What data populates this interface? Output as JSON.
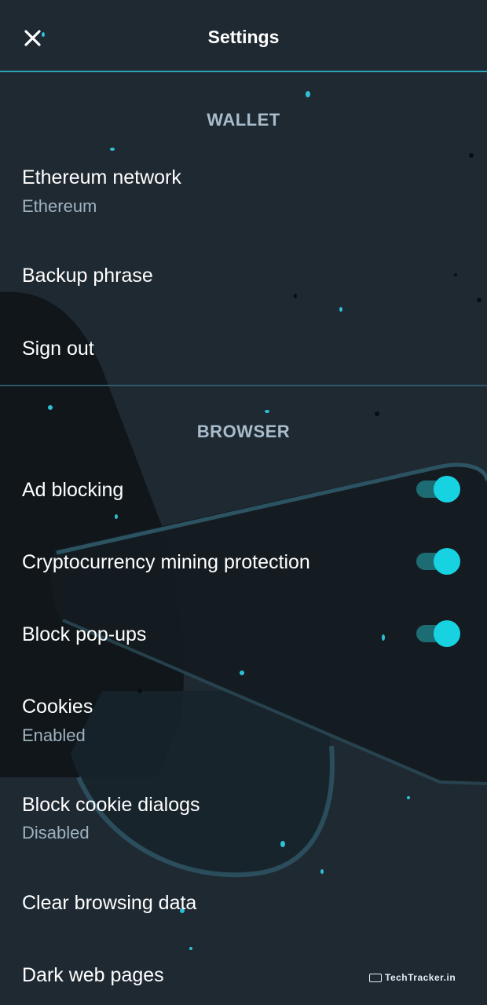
{
  "header": {
    "title": "Settings",
    "close_icon": "close-icon"
  },
  "wallet": {
    "title": "WALLET",
    "items": [
      {
        "label": "Ethereum network",
        "sub": "Ethereum"
      },
      {
        "label": "Backup phrase"
      },
      {
        "label": "Sign out"
      }
    ]
  },
  "browser": {
    "title": "BROWSER",
    "items": [
      {
        "label": "Ad blocking",
        "toggle_on": true
      },
      {
        "label": "Cryptocurrency mining protection",
        "toggle_on": true
      },
      {
        "label": "Block pop-ups",
        "toggle_on": true
      },
      {
        "label": "Cookies",
        "sub": "Enabled"
      },
      {
        "label": "Block cookie dialogs",
        "sub": "Disabled"
      },
      {
        "label": "Clear browsing data"
      },
      {
        "label": "Dark web pages"
      }
    ]
  },
  "watermark": {
    "text": "TechTracker.in"
  },
  "colors": {
    "background": "#1f2932",
    "accent": "#17d3e2",
    "header_rule": "#2aa6b4",
    "section_title": "#a9bccb",
    "subtitle": "#9fb2c0"
  }
}
